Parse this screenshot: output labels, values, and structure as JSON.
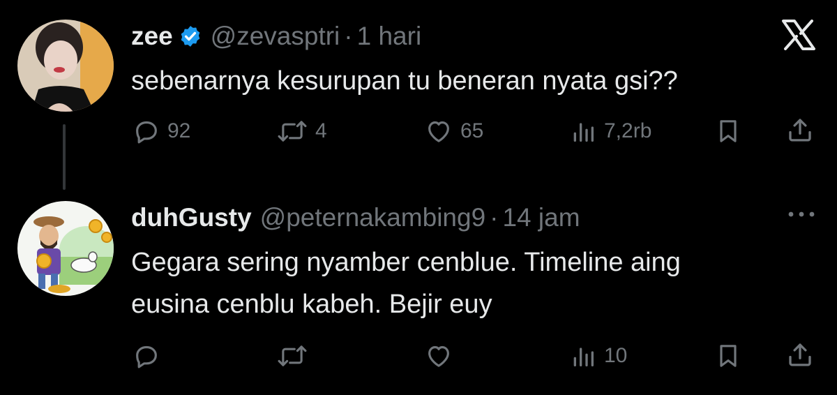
{
  "tweet": {
    "name": "zee",
    "handle": "@zevasptri",
    "separator": "·",
    "time": "1 hari",
    "text": "sebenarnya kesurupan tu beneran nyata gsi??",
    "replies": "92",
    "retweets": "4",
    "likes": "65",
    "views": "7,2rb",
    "icons": [
      "x-logo",
      "verified-badge",
      "reply-icon",
      "retweet-icon",
      "like-icon",
      "views-icon",
      "bookmark-icon",
      "share-icon"
    ]
  },
  "reply": {
    "name": "duhGusty",
    "handle": "@peternakambing9",
    "separator": "·",
    "time": "14 jam",
    "text_line1": "Gegara sering nyamber cenblue. Timeline aing",
    "text_line2": "eusina cenblu kabeh. Bejir euy",
    "replies": "",
    "retweets": "",
    "likes": "",
    "views": "10",
    "icons": [
      "more-icon",
      "reply-icon",
      "retweet-icon",
      "like-icon",
      "views-icon",
      "bookmark-icon",
      "share-icon"
    ]
  },
  "colors": {
    "background": "#000000",
    "text": "#e7e9ea",
    "muted": "#71767b",
    "verified": "#1d9bf0"
  }
}
